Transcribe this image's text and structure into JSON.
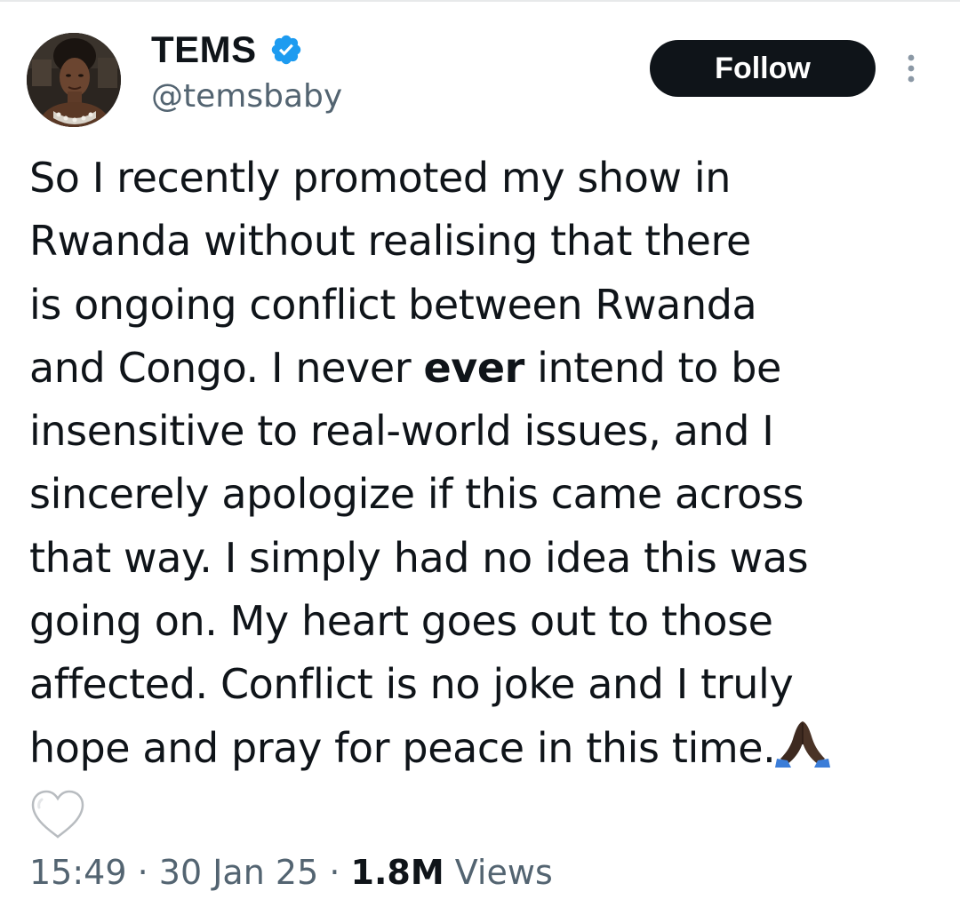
{
  "header": {
    "display_name": "TEMS",
    "handle": "@temsbaby",
    "verified_icon": "verified-badge-icon",
    "follow_label": "Follow",
    "more_icon": "more-vertical-icon"
  },
  "tweet": {
    "lines": [
      "So I recently promoted my show in",
      "Rwanda without realising that there",
      "is ongoing conflict between Rwanda",
      "and Congo. I never ",
      "ever",
      " intend to be",
      "insensitive to real-world issues, and I",
      "sincerely apologize if this came across",
      "that way. I simply had no idea this was",
      "going on. My heart goes out to those",
      "affected. Conflict is no joke and I truly",
      "hope and pray for peace in this time."
    ],
    "emojis": [
      "pray-icon",
      "white-heart-icon"
    ]
  },
  "meta": {
    "time": "15:49",
    "sep": "·",
    "date": "30 Jan 25",
    "views_count": "1.8M",
    "views_label": "Views"
  },
  "colors": {
    "text": "#0f1419",
    "secondary": "#536471",
    "verified": "#1d9bf0",
    "button": "#0f1419"
  }
}
